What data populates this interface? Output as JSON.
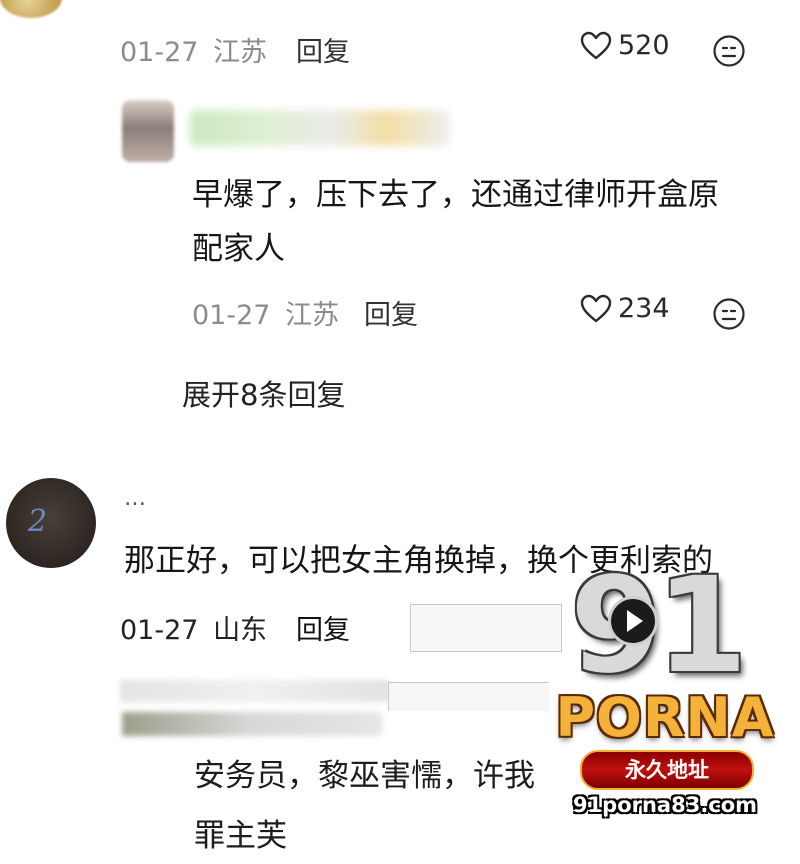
{
  "comment1": {
    "date": "01-27",
    "location": "江苏",
    "reply_label": "回复",
    "likes": "520"
  },
  "reply1": {
    "text_line1": "早爆了，压下去了，还通过律师开盒原",
    "text_line2": "配家人",
    "date": "01-27",
    "location": "江苏",
    "reply_label": "回复",
    "likes": "234"
  },
  "expand_replies": "展开8条回复",
  "comment2": {
    "username": "…",
    "text": "那正好，可以把女主角换掉，换个更利索的",
    "date": "01-27",
    "location": "山东",
    "reply_label": "回复"
  },
  "reply2": {
    "text_line1": "安务员，黎巫害懦，许我",
    "text_line2": "罪主芙"
  },
  "watermark": {
    "number": "91",
    "brand": "PORNA",
    "tagline": "永久地址",
    "url": "91porna83.com"
  },
  "icons": [
    "heart-icon",
    "neutral-face-icon",
    "play-icon"
  ],
  "colors": {
    "meta_gray": "#8b8b8b",
    "text": "#161616",
    "logo_gold": "#f4b23a",
    "logo_red": "#c01010"
  }
}
